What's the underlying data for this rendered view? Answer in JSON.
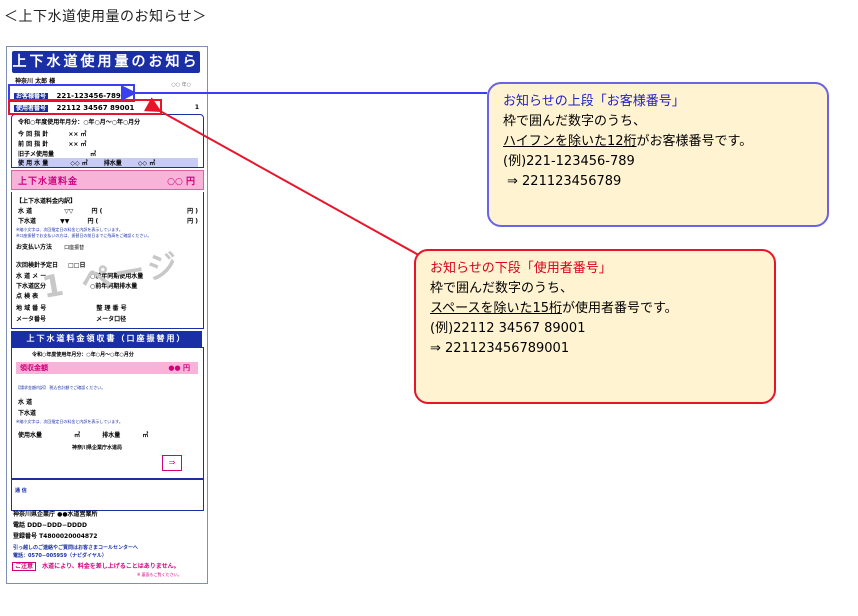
{
  "page_title": "＜上下水道使用量のお知らせ＞",
  "card": {
    "title": "上下水道使用量のお知らせ",
    "addressee": "神奈川 太郎 様",
    "date_label": "○○ 年○",
    "customer_label": "お客様番号",
    "customer_number": "221-123456-789",
    "user_label": "使用者番号",
    "user_number": "22112 34567 89001",
    "user_suffix": "1",
    "usage_period": "令和○年度使用年月分：○年○月〜○年○月分",
    "this_reading_label": "今 回 指 針",
    "this_reading_value": "×× ㎥",
    "last_reading_label": "前 回 指 針",
    "last_reading_value": "×× ㎥",
    "sub_label": "旧子メ使用量",
    "sub_value": "㎥",
    "usage_label": "使 用 水 量",
    "usage_value": "◇◇ ㎥",
    "sewer_usage_label": "排水量",
    "sewer_usage_value": "◇◇ ㎥",
    "fee_label": "上下水道料金",
    "fee_value": "○○ 円",
    "breakdown_label": "【上下水道料金内訳】",
    "water_label": "水 道",
    "water_value": "▽▽",
    "water_unit": "円 (",
    "water_end": "円 )",
    "sewer_label": "下水道",
    "sewer_value": "▼▼",
    "sewer_unit": "円 (",
    "sewer_end": "円 )",
    "note_line1": "※縮小文字は、次回指定日の料金と内訳を表示しています。",
    "note_line2": "※口座振替でお支払いの方は、振替日の前日までに残高をご確認ください。",
    "payment_label": "お支払い方法",
    "payment_value": "口座振替",
    "next_date_label": "次回検針予定日",
    "next_date_value": "□□日",
    "water_meter_label": "水 道 メ ー",
    "sewer_calc_label": "下水道区分",
    "water_div_label": "点 検 表",
    "area_label": "地 域 番 号",
    "area_value": "整 理 番 号",
    "meter_label": "メータ番号",
    "meter_value": "メータ口径",
    "prev_usage_label": "○前年同期使用水量",
    "prev_period_label": "○前年同期排水量",
    "watermark": "1 ページ",
    "bill_title": "上下水道料金領収書（口座振替用）",
    "bill_period": "令和○年度使用年月分：○年○月〜○年○月分",
    "receipt_label": "領収金額",
    "receipt_value": "●● 円",
    "bill_note": "【請求金額内訳】 税込合計額でご確認ください。",
    "bill_water": "水 道",
    "bill_sewer": "下水道",
    "bill_note2": "※縮小文字は、次回指定日の料金と内訳を表示しています。",
    "bill_usage": "使用水量",
    "bill_usage_unit": "㎥",
    "bill_sewer_usage": "排水量",
    "bill_sewer_unit": "㎥",
    "bill_office": "神奈川県企業庁水道局",
    "arrow": "⇒",
    "memo_mark": "通 信",
    "footer_org": "神奈川県企業庁 ●●水道営業所",
    "footer_tel": "電話 DDD−DDD−DDDD",
    "footer_reg": "登録番号 T4800020004872",
    "footer_contact": "引っ越しのご連絡やご質問はお客さまコールセンターへ",
    "footer_phone": "電話：0570−005959（ナビダイヤル）",
    "caution_tag": "ご注意",
    "caution_text": "水道により、料金を差し上げることはありません。",
    "caution_note": "※ 裏面もご覧ください。"
  },
  "callouts": {
    "customer": {
      "heading": "お知らせの上段「お客様番号」",
      "line1": "枠で囲んだ数字のうち、",
      "line2_u": "ハイフンを除いた12桁",
      "line2_rest": "がお客様番号です。",
      "example": "(例)221-123456-789",
      "result": "⇒  221123456789"
    },
    "user": {
      "heading": "お知らせの下段「使用者番号」",
      "line1": "枠で囲んだ数字のうち、",
      "line2_u": "スペースを除いた15桁",
      "line2_rest": "が使用者番号です。",
      "example": "(例)22112  34567  89001",
      "result": " ⇒  221123456789001"
    }
  },
  "colors": {
    "card_blue": "#1a2fa6",
    "fee_pink": "#f7b3d8",
    "callout_fill": "#fff3d2",
    "customer_frame": "#3a3ff0",
    "user_frame": "#e8142a"
  }
}
